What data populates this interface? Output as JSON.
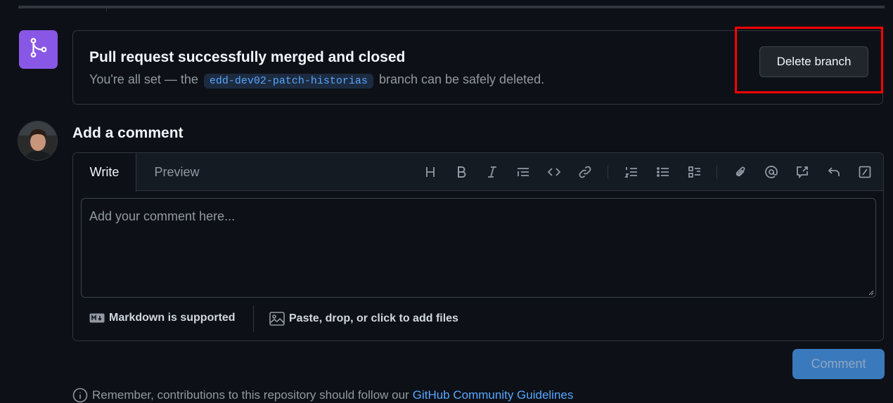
{
  "merge": {
    "title": "Pull request successfully merged and closed",
    "sub_before": "You're all set — the",
    "branch": "edd-dev02-patch-historias",
    "sub_after": "branch can be safely deleted.",
    "delete_label": "Delete branch",
    "badge_icon": "git-merge-icon",
    "badge_color": "#8957e5"
  },
  "comment": {
    "heading": "Add a comment",
    "tabs": [
      "Write",
      "Preview"
    ],
    "active_tab": "Write",
    "toolbar_icons": [
      "heading-icon",
      "bold-icon",
      "italic-icon",
      "quote-icon",
      "code-icon",
      "link-icon",
      "ordered-list-icon",
      "unordered-list-icon",
      "task-list-icon",
      "attach-icon",
      "mention-icon",
      "reference-icon",
      "reply-icon",
      "slash-command-icon"
    ],
    "placeholder": "Add your comment here...",
    "markdown_label": "Markdown is supported",
    "files_label": "Paste, drop, or click to add files",
    "submit_label": "Comment"
  },
  "footer": {
    "remember_text": "Remember, contributions to this repository should follow our",
    "guidelines_link": "GitHub Community Guidelines"
  },
  "colors": {
    "accent": "#58a6ff",
    "highlight": "#ff0000",
    "bg": "#0d1117"
  }
}
